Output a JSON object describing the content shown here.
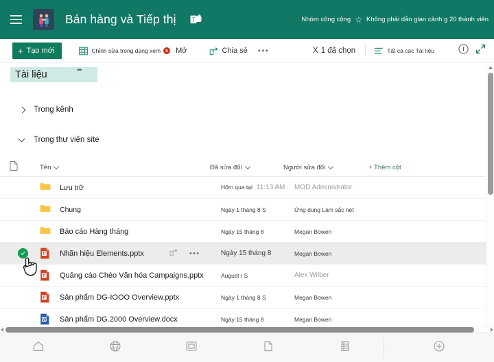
{
  "header": {
    "menu_icon": "hamburger-icon",
    "avatar_icon": "team-handshake-avatar",
    "team_title": "Bán hàng và Tiếp thị",
    "teams_icon": "microsoft-teams-icon",
    "privacy_label": "Nhóm công cộng",
    "favorite_icon": "star-icon",
    "members_label": "Không phải dẫn gian cảnh g 20 thành viên",
    "bg_color": "#117865"
  },
  "toolbar": {
    "new_label": "Tạo mới",
    "new_plus": "+",
    "grid_edit_icon": "grid-icon",
    "grid_edit_label": "Chỉnh sửa trong dạng xem",
    "presence_avatar": "user-avatar-badge",
    "open_label": "Mở",
    "share_icon": "share-icon",
    "share_label": "Chia sẻ",
    "more_label": "•••",
    "selected_close": "X",
    "selected_label": "1 đã chọn",
    "view_icon": "list-view-icon",
    "view_label": "Tất cả các Tài liệu",
    "info_icon": "info-icon",
    "expand_icon": "expand-icon",
    "accent_color": "#107c5f"
  },
  "library": {
    "title": "Tài liệu",
    "title_mark": "•••",
    "tree": [
      {
        "label": "Trong kênh",
        "expanded": false,
        "icon": "chevron-right-icon"
      },
      {
        "label": "Trong thư viện site",
        "expanded": true,
        "icon": "chevron-down-icon"
      }
    ]
  },
  "table": {
    "columns": {
      "file_icon": "file-type-icon",
      "name": "Tên",
      "modified": "Đã sửa đổi",
      "modified_by": "Người sửa đổi",
      "add_column": "+ Thêm cột"
    },
    "rows": [
      {
        "name": "Lưu trữ",
        "kind": "folder",
        "modified": "Hôm qua tại",
        "modified_time": "11:13 AM",
        "modified_by": "MOD Administrator",
        "selected": false
      },
      {
        "name": "Chung",
        "kind": "folder",
        "modified": "Ngày 1 tháng 8 S",
        "modified_time": "",
        "modified_by": "Ứng dụng Làm sắc nét",
        "selected": false
      },
      {
        "name": "Báo cáo Hàng tháng",
        "kind": "folder",
        "modified": "Ngày 15 tháng 8",
        "modified_time": "",
        "modified_by": "Megan Bowen",
        "selected": false
      },
      {
        "name": "Nhãn hiệu Elements.pptx",
        "kind": "powerpoint",
        "modified": "Ngày 15 tháng 8",
        "modified_time": "",
        "modified_by": "Megan Bowen",
        "selected": true,
        "row_share_icon": "share-icon",
        "row_more_icon": "more-icon"
      },
      {
        "name": "Quảng cáo Chéo Văn hóa Campaigns.pptx",
        "kind": "powerpoint",
        "modified": "August I S",
        "modified_time": "",
        "modified_by": "Alex Wilber",
        "selected": false
      },
      {
        "name": "Sản phẩm DG-IOOO Overview.pptx",
        "kind": "powerpoint",
        "modified": "Ngày 1 tháng 8 S",
        "modified_time": "",
        "modified_by": "Megan Bowen",
        "selected": false
      },
      {
        "name": "Sản phẩm DG.2000 Overview.docx",
        "kind": "word",
        "modified": "Ngày 15 tháng 8",
        "modified_time": "",
        "modified_by": "Megan Bowen",
        "selected": false
      }
    ]
  },
  "bottom_nav": {
    "items": [
      {
        "icon": "home-icon"
      },
      {
        "icon": "globe-icon"
      },
      {
        "icon": "conversations-icon"
      },
      {
        "icon": "file-icon"
      },
      {
        "icon": "list-icon"
      }
    ],
    "add_icon": "add-circle-icon"
  },
  "cursor": {
    "icon": "hand-pointer-cursor"
  }
}
